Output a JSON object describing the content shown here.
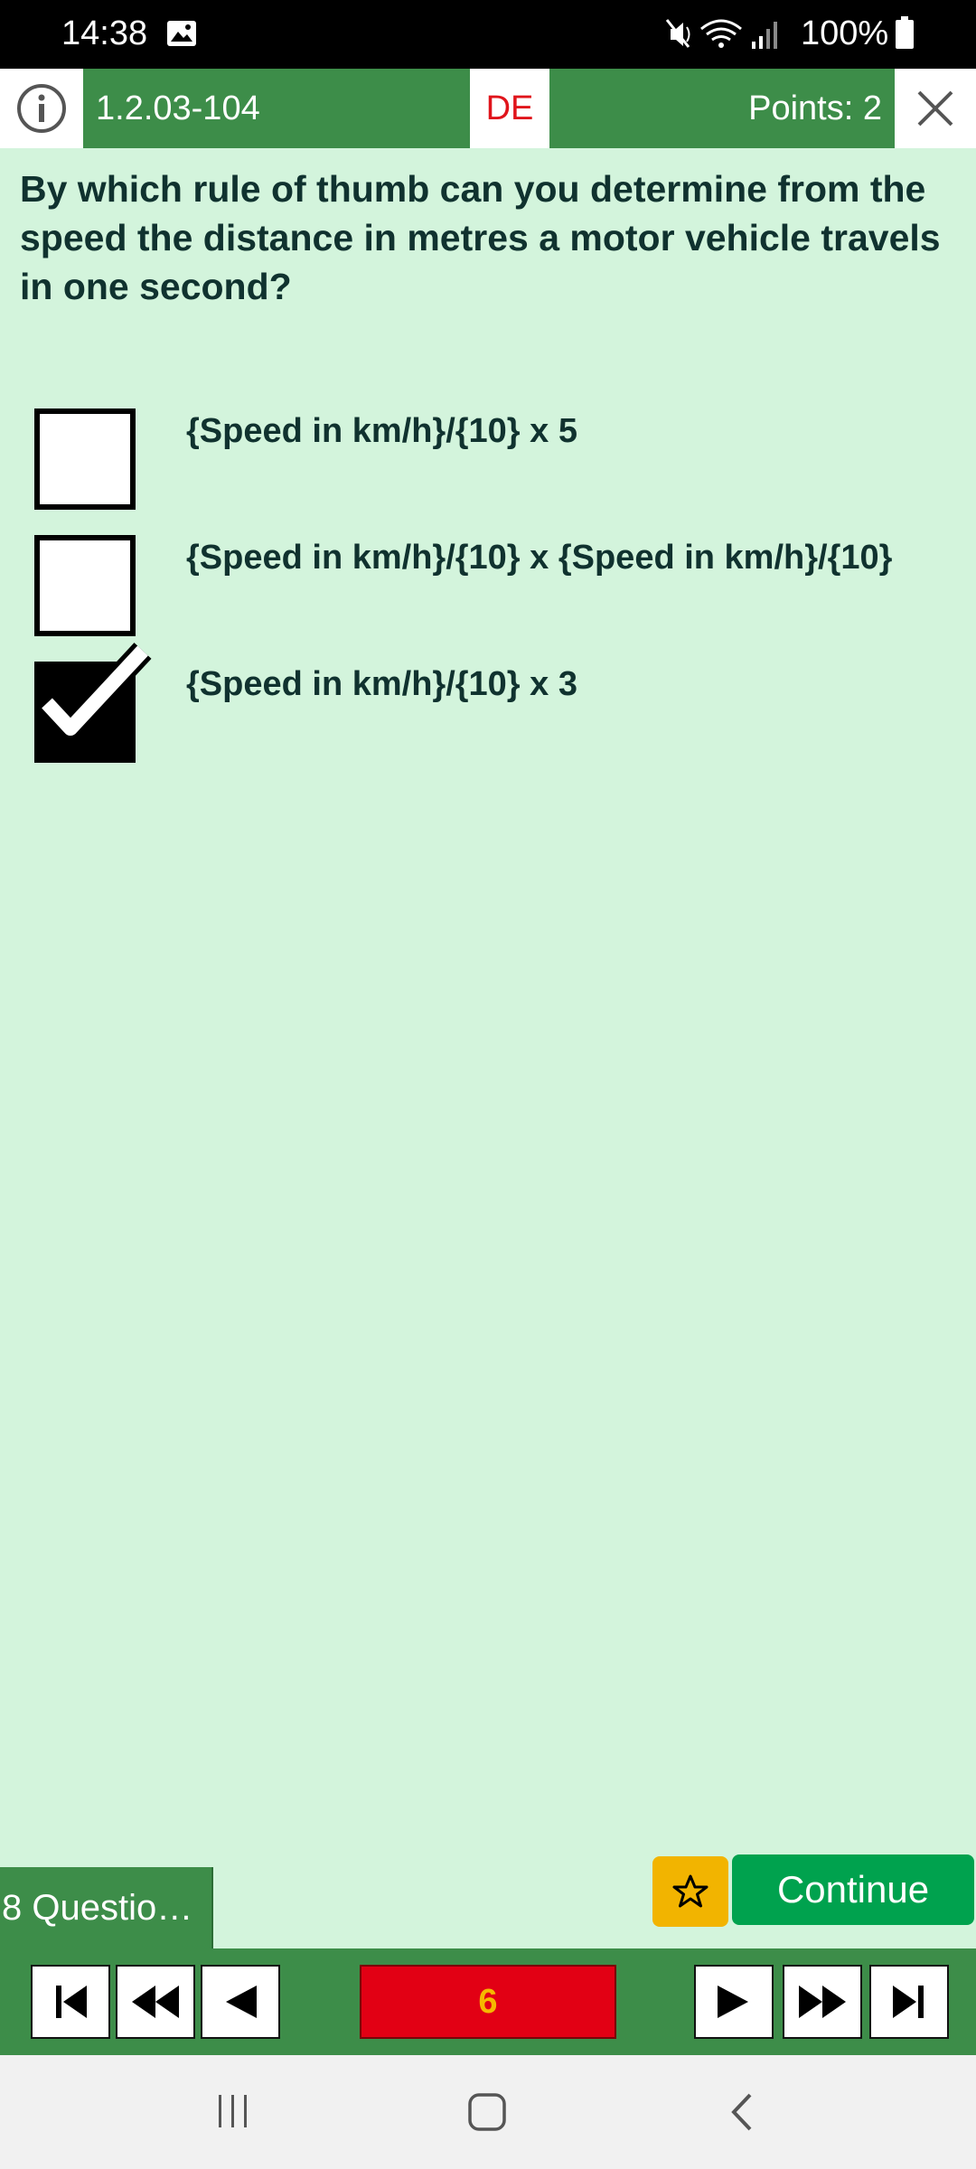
{
  "status_bar": {
    "time": "14:38",
    "battery_percent": "100%",
    "icons": [
      "image-icon",
      "mute-icon",
      "wifi-icon",
      "signal-icon",
      "battery-icon"
    ]
  },
  "header": {
    "question_id": "1.2.03-104",
    "language": "DE",
    "points": "Points: 2",
    "colors": {
      "bar": "#3d8d49",
      "language_text": "#e0141b"
    }
  },
  "question": {
    "text": "By which rule of thumb can you determine from the speed the distance in metres a motor vehicle travels in one second?"
  },
  "answers": [
    {
      "text": "{Speed in km/h}/{10} x 5",
      "checked": false
    },
    {
      "text": "{Speed in km/h}/{10} x {Speed in km/h}/{10}",
      "checked": false
    },
    {
      "text": "{Speed in km/h}/{10} x 3",
      "checked": true
    }
  ],
  "footer": {
    "questions_tab": "8 Questio…",
    "continue_label": "Continue",
    "current_question": "6",
    "colors": {
      "continue": "#00a24e",
      "star": "#f2b400",
      "counter_bg": "#e20014",
      "counter_text": "#f5b800"
    }
  },
  "system_nav": [
    "recents-icon",
    "home-icon",
    "back-icon"
  ]
}
